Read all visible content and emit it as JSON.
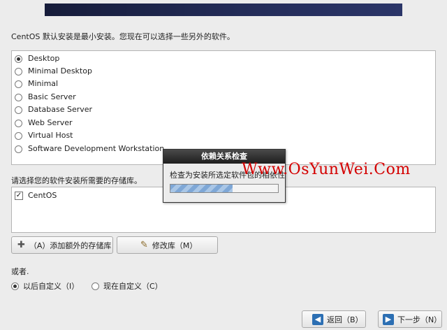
{
  "intro_text": "CentOS 默认安装是最小安装。您现在可以选择一些另外的软件。",
  "package_groups": [
    {
      "label": "Desktop",
      "selected": true
    },
    {
      "label": "Minimal Desktop",
      "selected": false
    },
    {
      "label": "Minimal",
      "selected": false
    },
    {
      "label": "Basic Server",
      "selected": false
    },
    {
      "label": "Database Server",
      "selected": false
    },
    {
      "label": "Web Server",
      "selected": false
    },
    {
      "label": "Virtual Host",
      "selected": false
    },
    {
      "label": "Software Development Workstation",
      "selected": false
    }
  ],
  "repo_label": "请选择您的软件安装所需要的存储库。",
  "repos": [
    {
      "label": "CentOS",
      "checked": true
    }
  ],
  "buttons": {
    "add_repo": "（A）添加额外的存储库",
    "modify_repo": "修改库（M）",
    "back": "返回（B）",
    "next": "下一步（N）"
  },
  "customize": {
    "label": "或者.",
    "later": "以后自定义（I）",
    "now": "现在自定义（C）",
    "selected": "later"
  },
  "dialog": {
    "title": "依赖关系检查",
    "message": "检查为安装所选定软件包的相依性",
    "progress": 0.58
  },
  "watermark": "Www.OsYunWei.Com",
  "icons": {
    "add": "plus-icon",
    "modify": "edit-icon",
    "back": "arrow-left-icon",
    "next": "arrow-right-icon"
  }
}
